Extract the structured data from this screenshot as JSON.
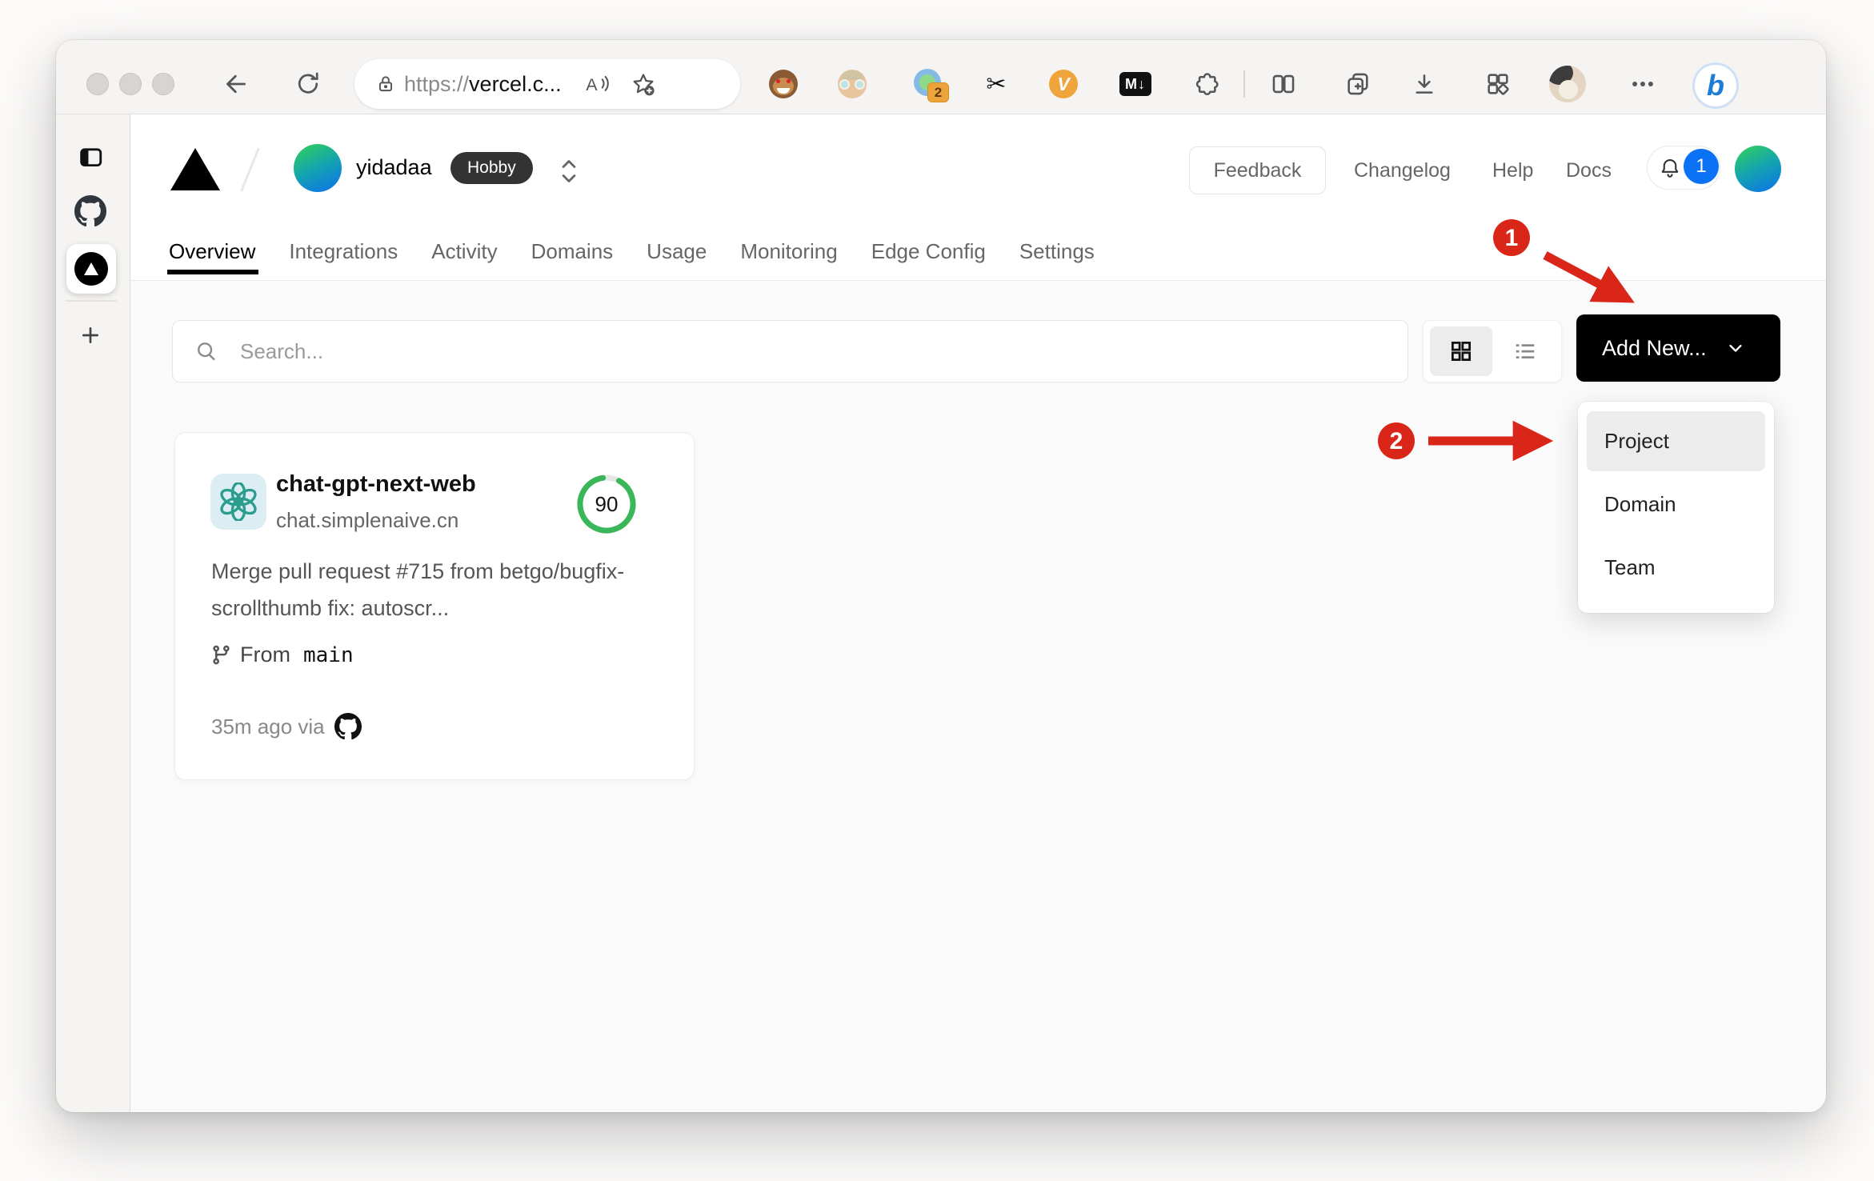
{
  "colors": {
    "accent_blue": "#0b72f5",
    "annotation_red": "#d92619",
    "gauge_green": "#3ab759",
    "add_new_bg": "#000000",
    "hobby_badge_bg": "#333333"
  },
  "browser": {
    "url": {
      "scheme": "https://",
      "host_visible": "vercel.c..."
    },
    "extension_badge_count": "2",
    "glyphs": {
      "scissors": "✂",
      "markdown": "M↓",
      "v_extension": "V",
      "bing": "b"
    }
  },
  "header": {
    "team_name": "yidadaa",
    "plan_badge": "Hobby",
    "feedback_label": "Feedback",
    "links": [
      {
        "label": "Changelog"
      },
      {
        "label": "Help"
      },
      {
        "label": "Docs"
      }
    ],
    "notification_count": "1"
  },
  "tabs": {
    "items": [
      {
        "label": "Overview"
      },
      {
        "label": "Integrations"
      },
      {
        "label": "Activity"
      },
      {
        "label": "Domains"
      },
      {
        "label": "Usage"
      },
      {
        "label": "Monitoring"
      },
      {
        "label": "Edge Config"
      },
      {
        "label": "Settings"
      }
    ]
  },
  "controls": {
    "search_placeholder": "Search...",
    "add_new_label": "Add New..."
  },
  "add_new_menu": {
    "items": [
      {
        "label": "Project"
      },
      {
        "label": "Domain"
      },
      {
        "label": "Team"
      }
    ]
  },
  "project_card": {
    "name": "chat-gpt-next-web",
    "domain": "chat.simplenaive.cn",
    "score": "90",
    "commit_message": "Merge pull request #715 from betgo/bugfix-scrollthumb fix: autoscr...",
    "branch_label": "From",
    "branch_name": "main",
    "deploy_meta": "35m ago via"
  },
  "annotations": {
    "step1": "1",
    "step2": "2"
  }
}
